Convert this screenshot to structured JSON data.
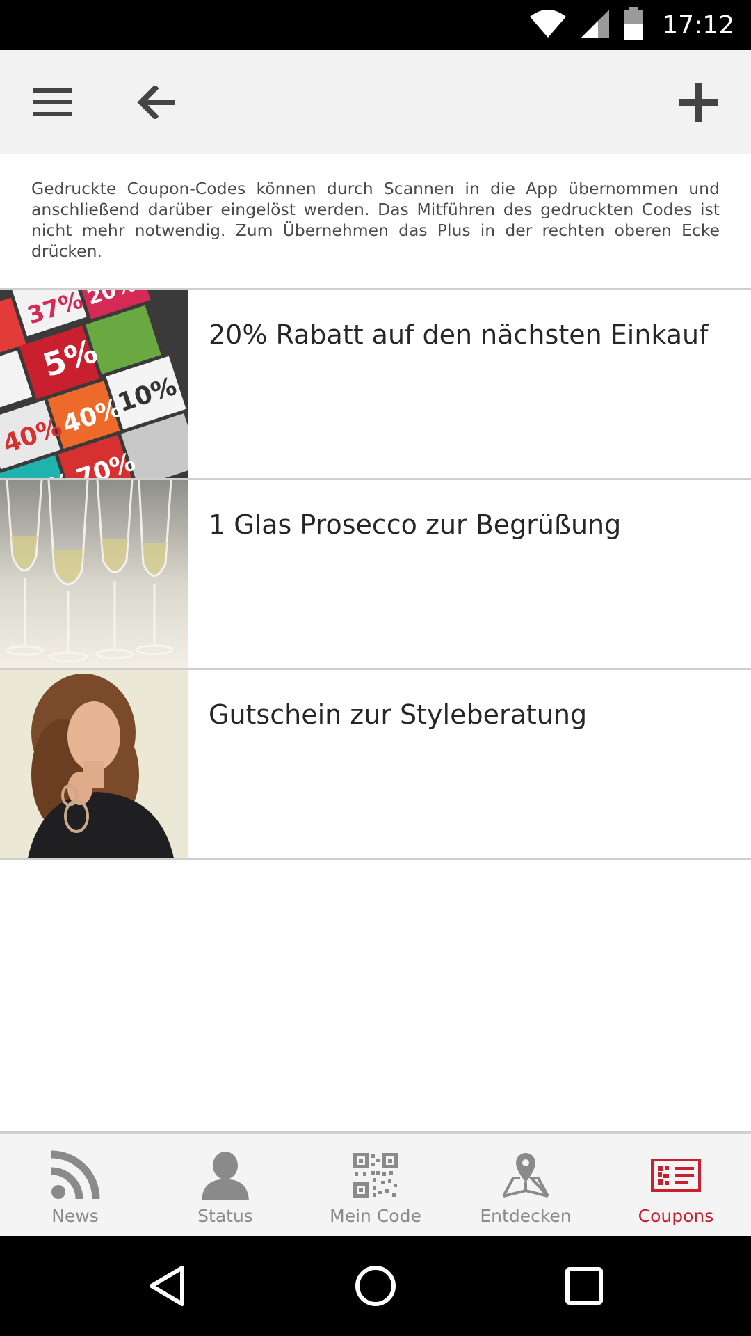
{
  "status_bar": {
    "time": "17:12",
    "icons": [
      "wifi-icon",
      "cell-signal-icon",
      "battery-icon"
    ]
  },
  "toolbar": {
    "menu_icon": "menu-icon",
    "back_icon": "back-arrow-icon",
    "add_icon": "plus-icon"
  },
  "info_text": "Gedruckte Coupon-Codes können durch Scannen in die App übernommen und anschließend darüber eingelöst werden. Das Mitführen des gedruckten Codes ist nicht mehr notwendig. Zum Übernehmen das Plus in der rechten oberen Ecke drücken.",
  "coupons": [
    {
      "title": "20% Rabatt auf den nächsten Einkauf"
    },
    {
      "title": "1 Glas Prosecco zur Begrüßung"
    },
    {
      "title": "Gutschein zur Styleberatung"
    }
  ],
  "bottom_nav": {
    "items": [
      {
        "label": "News",
        "icon": "rss-icon",
        "active": false
      },
      {
        "label": "Status",
        "icon": "person-icon",
        "active": false
      },
      {
        "label": "Mein Code",
        "icon": "qr-code-icon",
        "active": false
      },
      {
        "label": "Entdecken",
        "icon": "map-pin-icon",
        "active": false
      },
      {
        "label": "Coupons",
        "icon": "coupon-icon",
        "active": true
      }
    ]
  },
  "colors": {
    "accent": "#c8202e",
    "toolbar_bg": "#f2f2f2",
    "nav_inactive": "#8a8a8a"
  }
}
